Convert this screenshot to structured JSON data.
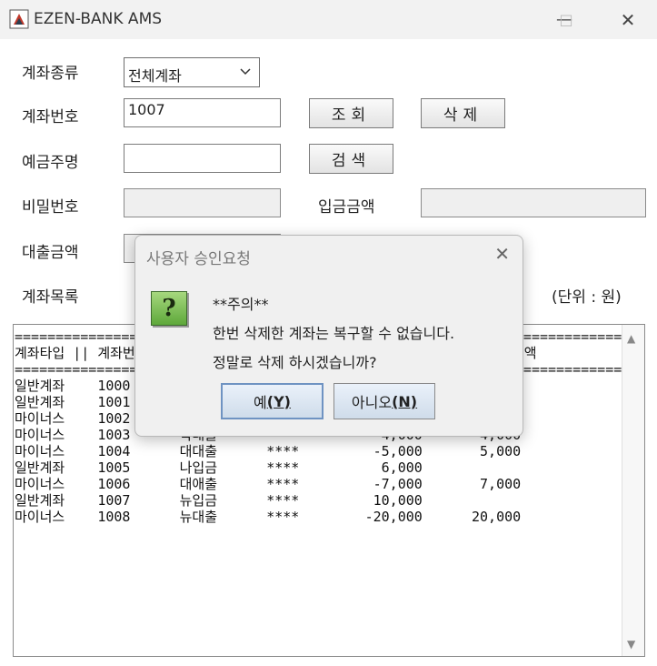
{
  "window": {
    "title": "EZEN-BANK AMS",
    "minimize": "—",
    "maximize": "□",
    "close": "✕"
  },
  "form": {
    "account_type_label": "계좌종류",
    "account_type_value": "전체계좌",
    "account_number_label": "계좌번호",
    "account_number_value": "1007",
    "search_button": "조회",
    "delete_button": "삭제",
    "holder_label": "예금주명",
    "holder_value": "",
    "find_button": "검색",
    "password_label": "비밀번호",
    "deposit_label": "입금금액",
    "loan_label": "대출금액",
    "list_label": "계좌목록",
    "unit_label": "(단위 : 원)"
  },
  "list": {
    "text": "===========================================================================\n계좌타입 || 계좌번호 || 예금주명 || 비밀번호 ||    잔    액   ||  대출금액\n===========================================================================\n일반계좌    1000      홍길동      ****         30,000\n일반계좌    1001      김길동      ****         40,000\n마이너스    1002      이대출      ****         -3,000       3,000\n마이너스    1003      박대출      ****         -4,000       4,000\n마이너스    1004      대대출      ****         -5,000       5,000\n일반계좌    1005      나입금      ****          6,000\n마이너스    1006      대애출      ****         -7,000       7,000\n일반계좌    1007      뉴입금      ****         10,000\n마이너스    1008      뉴대출      ****        -20,000      20,000"
  },
  "dialog": {
    "title": "사용자 승인요청",
    "close": "✕",
    "icon": "question-icon",
    "line1": "**주의**",
    "line2": "한번 삭제한 계좌는 복구할 수 없습니다.",
    "line3": "정말로 삭제 하시겠습니까?",
    "yes_text": "예",
    "yes_mnemonic": "(Y)",
    "no_text": "아니오",
    "no_mnemonic": "(N)"
  },
  "colors": {
    "accent_focus": "#6f93c2",
    "question_icon_green": "#5ea83a"
  }
}
